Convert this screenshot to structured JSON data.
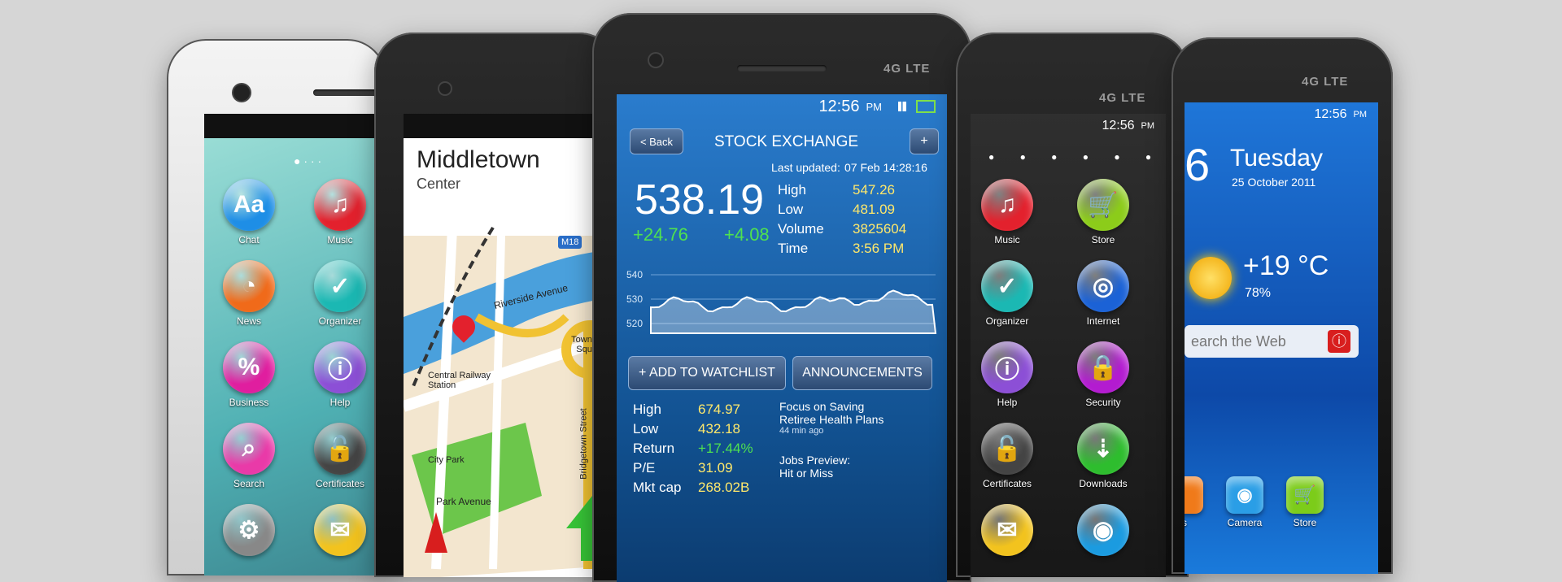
{
  "status": {
    "time": "12:56",
    "ampm": "PM",
    "network": "4G LTE"
  },
  "phone1": {
    "apps": [
      {
        "label": "Chat",
        "glyph": "Aa",
        "color": "#1e8ee6"
      },
      {
        "label": "Music",
        "glyph": "♫",
        "color": "#e3212d"
      },
      {
        "label": "News",
        "glyph": "◔",
        "color": "#f06a1a"
      },
      {
        "label": "Organizer",
        "glyph": "✓",
        "color": "#1bb8b3"
      },
      {
        "label": "Business",
        "glyph": "%",
        "color": "#e01e9f"
      },
      {
        "label": "Help",
        "glyph": "ⓘ",
        "color": "#8c4fd6"
      },
      {
        "label": "Search",
        "glyph": "⌕",
        "color": "#e93aa8"
      },
      {
        "label": "Certificates",
        "glyph": "🔓",
        "color": "#444444"
      },
      {
        "label": "",
        "glyph": "⚙",
        "color": "#888888"
      },
      {
        "label": "",
        "glyph": "✉",
        "color": "#f2c31e"
      }
    ]
  },
  "phone2": {
    "city": "Middletown",
    "area": "Center",
    "road_badge": "M18",
    "labels": {
      "riverside": "Riverside Avenue",
      "townhall": "Town Hall Square",
      "railway": "Central Railway Station",
      "park": "City Park",
      "parkave": "Park Avenue",
      "bridgetown": "Bridgetown Street"
    }
  },
  "phone3": {
    "back_label": "< Back",
    "title": "STOCK EXCHANGE",
    "add_label": "+",
    "updated_label": "Last updated:",
    "updated_value": "07 Feb 14:28:16",
    "price": "538.19",
    "change_abs": "+24.76",
    "change_pct": "+4.08",
    "stats": [
      {
        "label": "High",
        "value": "547.26"
      },
      {
        "label": "Low",
        "value": "481.09"
      },
      {
        "label": "Volume",
        "value": "3825604"
      },
      {
        "label": "Time",
        "value": "3:56 PM"
      }
    ],
    "chart_ticks": [
      "540",
      "530",
      "520"
    ],
    "watchlist_label": "+ ADD TO WATCHLIST",
    "announcements_label": "ANNOUNCEMENTS",
    "lower_stats": [
      {
        "label": "High",
        "value": "674.97"
      },
      {
        "label": "Low",
        "value": "432.18"
      },
      {
        "label": "Return",
        "value": "+17.44%"
      },
      {
        "label": "P/E",
        "value": "31.09"
      },
      {
        "label": "Mkt cap",
        "value": "268.02B"
      }
    ],
    "news": [
      {
        "headline1": "Focus on Saving",
        "headline2": "Retiree Health Plans",
        "age": "44 min ago"
      },
      {
        "headline1": "Jobs Preview:",
        "headline2": "Hit or Miss",
        "age": ""
      }
    ]
  },
  "phone4": {
    "apps": [
      {
        "label": "Music",
        "glyph": "♫",
        "color": "#e3212d"
      },
      {
        "label": "Store",
        "glyph": "🛒",
        "color": "#8ccc1a"
      },
      {
        "label": "Organizer",
        "glyph": "✓",
        "color": "#1bb8b3"
      },
      {
        "label": "Internet",
        "glyph": "◎",
        "color": "#1b62d6"
      },
      {
        "label": "Help",
        "glyph": "ⓘ",
        "color": "#8c4fd6"
      },
      {
        "label": "Security",
        "glyph": "🔒",
        "color": "#b31bd0"
      },
      {
        "label": "Certificates",
        "glyph": "🔓",
        "color": "#444444"
      },
      {
        "label": "Downloads",
        "glyph": "⇣",
        "color": "#2ebd2e"
      },
      {
        "label": "",
        "glyph": "✉",
        "color": "#f2c31e"
      },
      {
        "label": "",
        "glyph": "◉",
        "color": "#1b9be0"
      }
    ]
  },
  "phone5": {
    "day_num": "6",
    "day_name": "Tuesday",
    "date": "25 October 2011",
    "temp": "+19 °C",
    "humidity": "78%",
    "search_placeholder": "earch the Web",
    "apps": [
      {
        "label": "s"
      },
      {
        "label": "Camera"
      },
      {
        "label": "Store"
      }
    ]
  }
}
